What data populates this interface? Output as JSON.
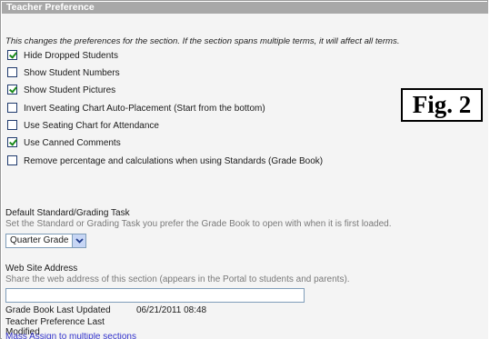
{
  "header": {
    "title": "Teacher Preference"
  },
  "intro": "This changes the preferences for the section. If the section spans multiple terms, it will affect all terms.",
  "options": [
    {
      "label": "Hide Dropped Students",
      "checked": true
    },
    {
      "label": "Show Student Numbers",
      "checked": false
    },
    {
      "label": "Show Student Pictures",
      "checked": true
    },
    {
      "label": "Invert Seating Chart Auto-Placement (Start from the bottom)",
      "checked": false
    },
    {
      "label": "Use Seating Chart for Attendance",
      "checked": false
    },
    {
      "label": "Use Canned Comments",
      "checked": true
    },
    {
      "label": "Remove percentage and calculations when using Standards (Grade Book)",
      "checked": false
    }
  ],
  "figure_label": "Fig. 2",
  "default_task": {
    "title": "Default Standard/Grading Task",
    "description": "Set the Standard or Grading Task you prefer the Grade Book to open with when it is first loaded.",
    "selected": "Quarter Grade"
  },
  "website": {
    "title": "Web Site Address",
    "description": "Share the web address of this section (appears in the Portal to students and parents).",
    "value": ""
  },
  "grade_book_updated": {
    "label": "Grade Book Last Updated",
    "value": "06/21/2011 08:48"
  },
  "teacher_pref_modified": {
    "label_line1": "Teacher Preference Last",
    "label_line2": "Modified"
  },
  "mass_assign_link": "Mass Assign to multiple sections"
}
